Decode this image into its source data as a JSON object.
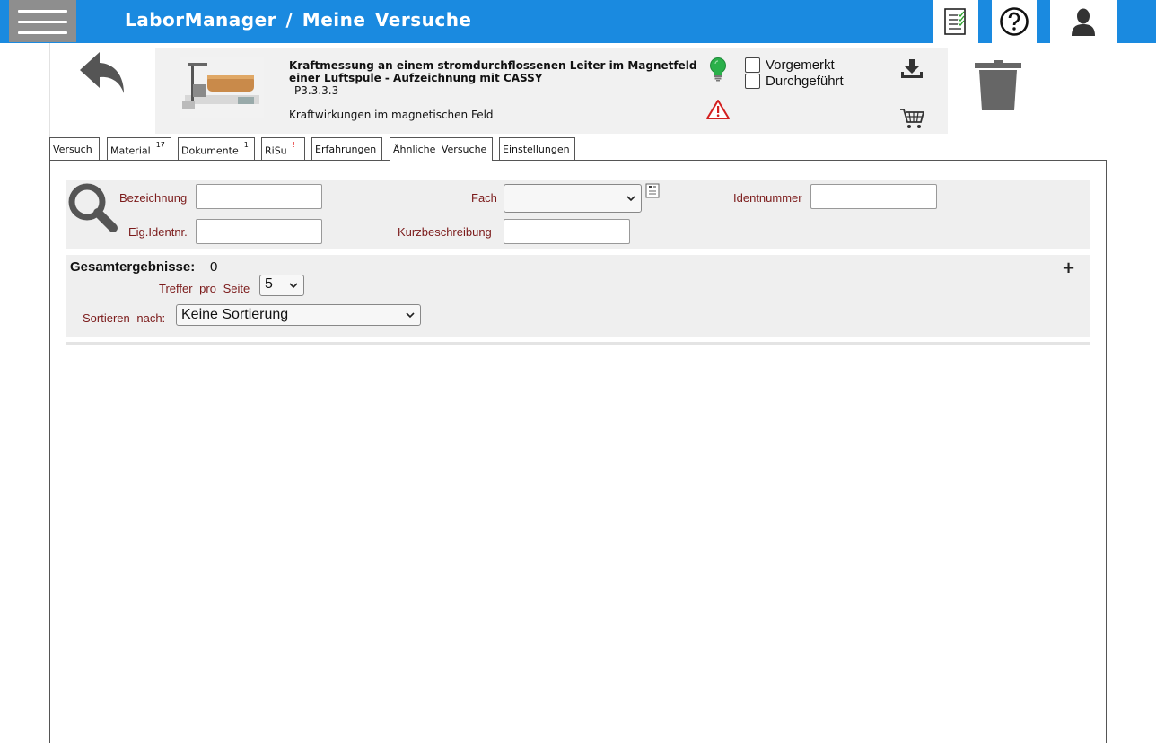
{
  "header": {
    "app_name": "LaborManager",
    "separator": "/",
    "page": "Meine Versuche"
  },
  "experiment": {
    "title": "Kraftmessung an einem stromdurchflossenen Leiter im Magnetfeld einer Luftspule - Aufzeichnung mit CASSY",
    "number": "P3.3.3.3",
    "topic": "Kraftwirkungen im magnetischen Feld",
    "checkbox_noted": "Vorgemerkt",
    "checkbox_done": "Durchgeführt",
    "noted_checked": false,
    "done_checked": false
  },
  "tabs": [
    {
      "label": "Versuch",
      "badge": ""
    },
    {
      "label": "Material",
      "badge": "17"
    },
    {
      "label": "Dokumente",
      "badge": "1"
    },
    {
      "label": "RiSu",
      "badge": "!"
    },
    {
      "label": "Erfahrungen",
      "badge": ""
    },
    {
      "label": "Ähnliche Versuche",
      "badge": "",
      "active": true
    },
    {
      "label": "Einstellungen",
      "badge": ""
    }
  ],
  "search": {
    "label_name": "Bezeichnung",
    "label_subject": "Fach",
    "label_id": "Identnummer",
    "label_own_id": "Eig.Identnr.",
    "label_description": "Kurzbeschreibung",
    "value_name": "",
    "value_subject": "",
    "value_id": "",
    "value_own_id": "",
    "value_description": ""
  },
  "results": {
    "total_label": "Gesamtergebnisse:",
    "total_count": "0",
    "per_page_label": "Treffer pro Seite",
    "per_page_value": "5",
    "sort_label": "Sortieren nach:",
    "sort_value": "Keine Sortierung",
    "expand_symbol": "+"
  },
  "colors": {
    "topbar": "#1a8ae0",
    "label_text": "#7b1a1a",
    "panel_bg": "#efefef"
  },
  "icons": [
    "menu-icon",
    "tasklist-icon",
    "help-icon",
    "user-icon",
    "back-arrow-icon",
    "lightbulb-icon",
    "warning-icon",
    "download-icon",
    "cart-icon",
    "trash-icon",
    "search-icon",
    "info-icon",
    "chevron-down-icon"
  ]
}
